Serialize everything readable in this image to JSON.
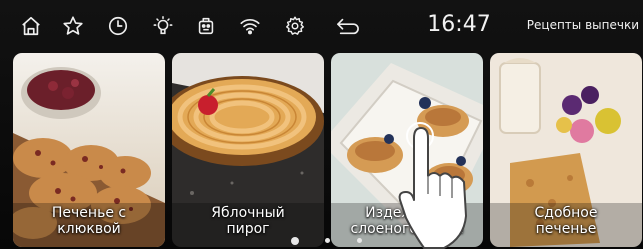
{
  "status_bar": {
    "icons": [
      "home-icon",
      "star-icon",
      "clock-icon",
      "light-bulb-icon",
      "robot-icon",
      "wifi-icon",
      "gear-icon",
      "back-icon"
    ],
    "time": "16:47",
    "title": "Рецепты выпечки"
  },
  "recipes": [
    {
      "label": "Печенье с\nклюквой"
    },
    {
      "label": "Яблочный\nпирог"
    },
    {
      "label": "Изделия из\nслоеного теста"
    },
    {
      "label": "Сдобное\nпеченье"
    }
  ],
  "pagination": {
    "pages": 3,
    "current": 1
  },
  "colors": {
    "background": "#0a0a0a",
    "text": "#f2f2f2"
  }
}
